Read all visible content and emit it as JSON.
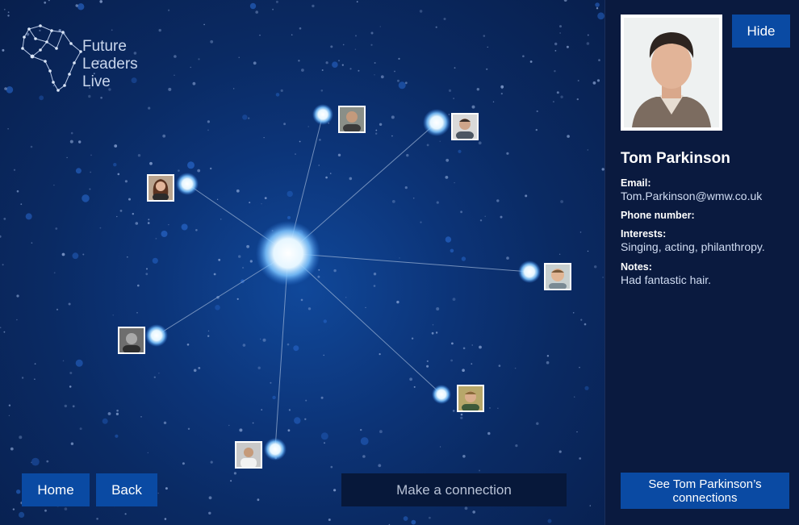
{
  "app": {
    "logo_text": "Future\nLeaders\nLive"
  },
  "nav": {
    "home_label": "Home",
    "back_label": "Back",
    "connect_label": "Make a connection"
  },
  "profile": {
    "hide_label": "Hide",
    "name": "Tom Parkinson",
    "email_label": "Email:",
    "email_value": "Tom.Parkinson@wmw.co.uk",
    "phone_label": "Phone number:",
    "phone_value": "",
    "interests_label": "Interests:",
    "interests_value": "Singing, acting, philanthropy.",
    "notes_label": "Notes:",
    "notes_value": "Had fantastic hair.",
    "connections_label": "See Tom Parkinson’s connections"
  },
  "colors": {
    "button": "#0a4aa3",
    "panel": "#0a1a3f",
    "node_glow": "#d9f1ff"
  },
  "icons": {
    "logo": "africa-constellation-icon",
    "person": "person-avatar-icon"
  }
}
